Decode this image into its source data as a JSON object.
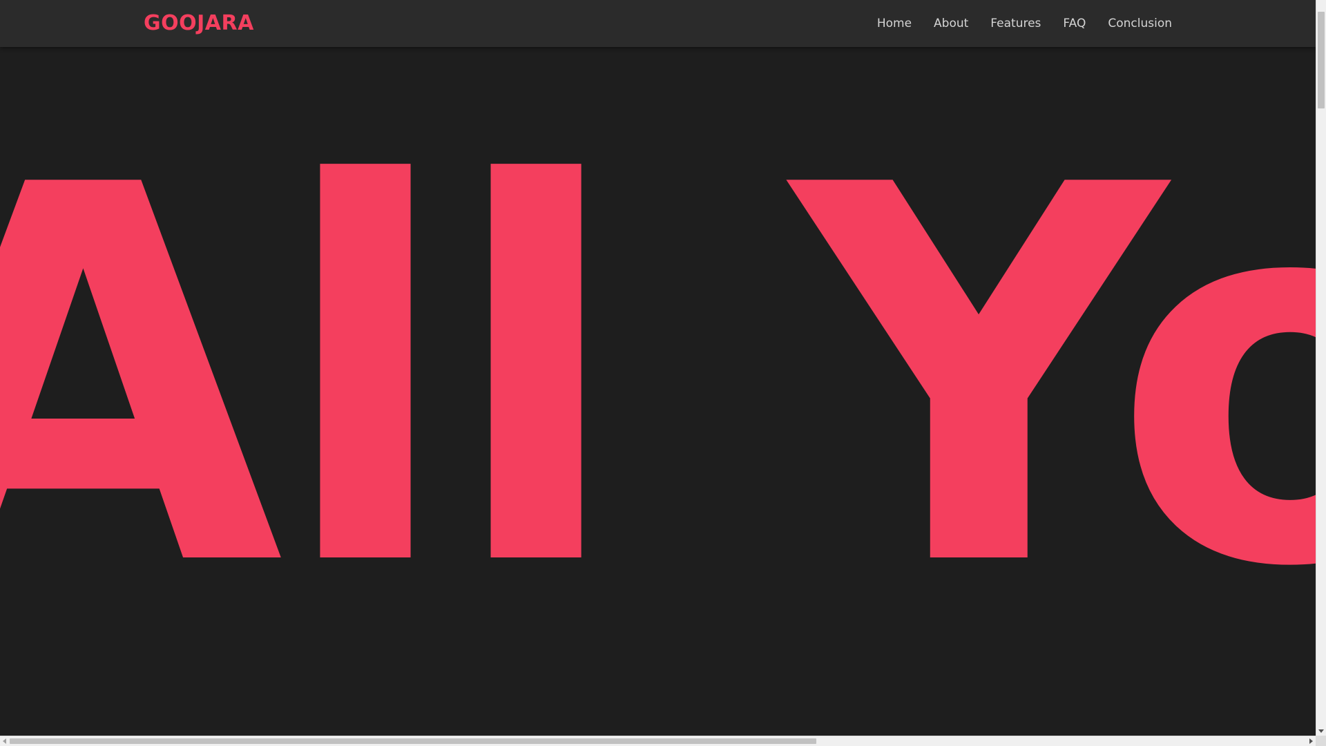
{
  "brand": {
    "name": "GOOJARA",
    "color": "#f43f5e"
  },
  "nav": {
    "items": [
      {
        "label": "Home"
      },
      {
        "label": "About"
      },
      {
        "label": "Features"
      },
      {
        "label": "FAQ"
      },
      {
        "label": "Conclusion"
      }
    ]
  },
  "hero": {
    "text": "All You",
    "color": "#f43f5e"
  },
  "theme": {
    "background": "#1e1e1e",
    "navbar_background": "#2b2b2b",
    "nav_text": "#d4d4d4"
  }
}
